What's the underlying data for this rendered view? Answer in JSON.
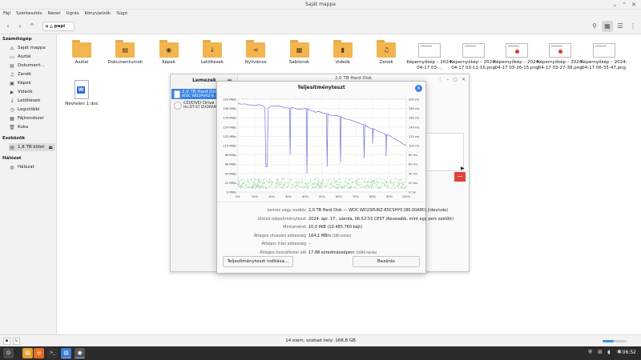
{
  "window": {
    "title": "Saját mappa",
    "controls": {
      "minimize": "⌄",
      "maximize": "⌃",
      "close": "✕"
    }
  },
  "menu": [
    "Fájl",
    "Szerkesztés",
    "Nézet",
    "Ugrás",
    "Könyvjelzők",
    "Súgó"
  ],
  "toolbar": {
    "path_crumb": "papi",
    "back_icon": "‹",
    "forward_icon": "›",
    "up_icon": "^",
    "toggle_icon": "◀",
    "home_icon": "⌂",
    "right_icons": [
      "⚲",
      "▦",
      "☰",
      "⋮"
    ]
  },
  "sidebar": {
    "sections": [
      {
        "title": "Számítógép",
        "items": [
          {
            "label": "Saját mappa",
            "icon": "⌂"
          },
          {
            "label": "Asztal",
            "icon": "▭"
          },
          {
            "label": "Dokument…",
            "icon": "▤"
          },
          {
            "label": "Zenék",
            "icon": "♫"
          },
          {
            "label": "Képek",
            "icon": "▣"
          },
          {
            "label": "Videók",
            "icon": "▶"
          },
          {
            "label": "Letöltések",
            "icon": "↓"
          },
          {
            "label": "Legutóbbi",
            "icon": "◷"
          },
          {
            "label": "Fájlrendszer",
            "icon": "▦"
          },
          {
            "label": "Kuka",
            "icon": "🗑"
          }
        ]
      },
      {
        "title": "Eszközök",
        "items": [
          {
            "label": "1,8 TB kötet",
            "icon": "▤",
            "eject": "⏏"
          }
        ]
      },
      {
        "title": "Hálózat",
        "items": [
          {
            "label": "Hálózat",
            "icon": "◍"
          }
        ]
      }
    ]
  },
  "files": [
    {
      "label": "Asztal",
      "type": "folder",
      "sym": ""
    },
    {
      "label": "Dokumentumok",
      "type": "folder",
      "sym": "▤"
    },
    {
      "label": "Képek",
      "type": "folder",
      "sym": "◉"
    },
    {
      "label": "Letöltések",
      "type": "folder",
      "sym": "↓"
    },
    {
      "label": "Nyilvános",
      "type": "folder",
      "sym": "⋖"
    },
    {
      "label": "Sablonok",
      "type": "folder",
      "sym": "▦"
    },
    {
      "label": "Videók",
      "type": "folder",
      "sym": "▮"
    },
    {
      "label": "Zenék",
      "type": "folder",
      "sym": "♫"
    },
    {
      "label": "Képernyőkép – 2024-04-17 03-…",
      "type": "image",
      "dot": false
    },
    {
      "label": "Képernyőkép – 2024-04-17 03-11-16.png",
      "type": "image",
      "dot": false
    },
    {
      "label": "Képernyőkép – 2024-04-17 03-26-15.png",
      "type": "image",
      "dot": true
    },
    {
      "label": "Képernyőkép – 2024-04-17 03-27-38.png",
      "type": "image",
      "dot": true
    },
    {
      "label": "Képernyőkép – 2024-04-17 06-35-47.png",
      "type": "image",
      "dot": false
    },
    {
      "label": "Névtelen 1.doc",
      "type": "doc",
      "sym": "W"
    }
  ],
  "status": {
    "text": "14 elem, szabad hely: 168,8 GB",
    "zoom_fraction": 0.45
  },
  "disks": {
    "header": "Lemezek",
    "menu_icon": "≡",
    "right_title": "2,0 TB Hard Disk",
    "controls": [
      "⋮",
      "–",
      "▢",
      "✕"
    ],
    "items": [
      {
        "t1": "2,0 TB Hard Disk",
        "t2": "WDC WD2PURZ-8…"
      },
      {
        "t1": "CD/DVD Drive",
        "t2": "HL-DT-ST DVDRAM …"
      }
    ],
    "red_button": "—",
    "play_icon": "▶"
  },
  "bench": {
    "title": "Teljesítményteszt",
    "close": "✕",
    "info": [
      {
        "k": "Lemez vagy eszköz",
        "v": "2,0 TB Hard Disk — WDC WD2SPURZ-85CSHY0 [80.00A80] (/dev/sda)"
      },
      {
        "k": "Utolsó teljesítményteszt",
        "v": "2024. ápr. 17., szerda, 06:52:53 CEST (Kevesebb, mint egy perc ezelőtt)"
      },
      {
        "k": "Mintaméret",
        "v": "10,0 MiB (10.485.760 bájt)"
      },
      {
        "k": "Átlagos olvasási sebesség",
        "v": "164,1 MB/s",
        "s": "(100 minta)"
      },
      {
        "k": "Átlagos írási sebesség",
        "v": "–"
      },
      {
        "k": "Átlagos hozzáférési idő",
        "v": "17,88 ezredmásodperc",
        "s": "(1000 minta)"
      }
    ],
    "start_button": "Teljesítményteszt indítása…",
    "close_button": "Bezárás"
  },
  "chart_data": {
    "type": "line",
    "x": [
      0,
      2,
      4,
      6,
      8,
      10,
      12,
      14,
      16,
      17,
      18,
      20,
      22,
      24,
      26,
      28,
      30,
      32,
      34,
      36,
      38,
      40,
      42,
      44,
      46,
      48,
      50,
      52,
      54,
      56,
      58,
      60,
      62,
      64,
      66,
      68,
      70,
      72,
      74,
      76,
      78,
      80,
      82,
      84,
      86,
      88,
      90,
      92,
      94,
      96,
      98,
      100
    ],
    "series": [
      {
        "values": [
          210,
          208,
          209,
          207,
          206,
          205,
          207,
          206,
          200,
          60,
          200,
          204,
          203,
          205,
          202,
          200,
          199,
          201,
          198,
          196,
          197,
          198,
          195,
          193,
          189,
          191,
          188,
          186,
          183,
          181,
          182,
          179,
          176,
          173,
          172,
          169,
          166,
          163,
          160,
          158,
          152,
          150,
          147,
          143,
          140,
          136,
          134,
          128,
          124,
          120,
          114,
          110
        ]
      }
    ],
    "dips": [
      {
        "x": 17,
        "y": 60
      },
      {
        "x": 31,
        "y": 88
      },
      {
        "x": 41,
        "y": 44
      },
      {
        "x": 53,
        "y": 60
      },
      {
        "x": 61,
        "y": 70
      },
      {
        "x": 75,
        "y": 80
      },
      {
        "x": 80,
        "y": 115
      },
      {
        "x": 88,
        "y": 85
      }
    ],
    "x_ticks": [
      "0%",
      "10%",
      "20%",
      "30%",
      "40%",
      "50%",
      "60%",
      "70%",
      "80%",
      "90%",
      "100%"
    ],
    "y_left_ticks": [
      "220 MB/s",
      "198 MB/s",
      "176 MB/s",
      "154 MB/s",
      "132 MB/s",
      "110 MB/s",
      "88 MB/s",
      "66 MB/s",
      "44 MB/s",
      "22 MB/s",
      "0 MB/s"
    ],
    "y_right_ticks": [
      "200 ms",
      "180 ms",
      "160 ms",
      "140 ms",
      "120 ms",
      "100 ms",
      "80 ms",
      "60 ms",
      "40 ms",
      "20 ms",
      "0 ms"
    ],
    "ylim": [
      0,
      220
    ],
    "access_time_band_ms": [
      8,
      30
    ],
    "colors": {
      "read": "#6f74d8",
      "access": "#4caf50"
    }
  },
  "taskbar": {
    "apps": [
      {
        "name": "menu",
        "icon": "⊙"
      },
      {
        "name": "files",
        "icon": "▤"
      },
      {
        "name": "firefox",
        "icon": "◎"
      },
      {
        "name": "terminal",
        "icon": ">_"
      },
      {
        "name": "file-manager",
        "icon": "▤"
      },
      {
        "name": "disks",
        "icon": "◉"
      }
    ],
    "tray": [
      "⛨",
      "⊞",
      "◖",
      "✱",
      "▸"
    ],
    "clock": "06:52"
  }
}
